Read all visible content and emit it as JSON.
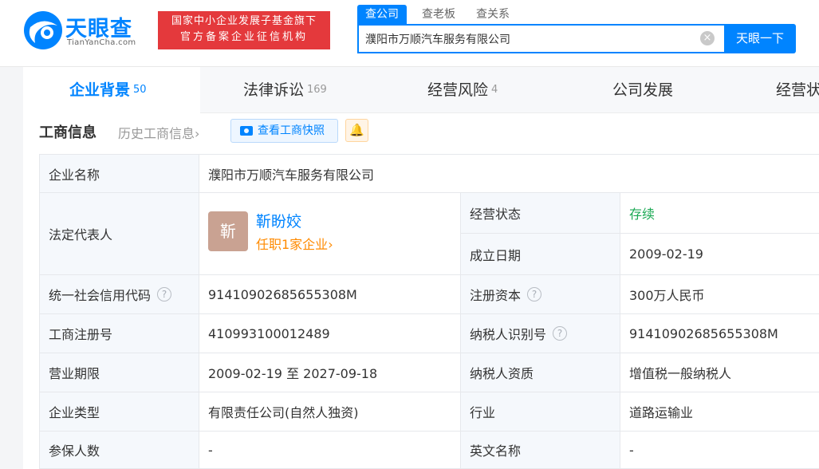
{
  "header": {
    "logo_cn": "天眼查",
    "logo_en": "TianYanCha.com",
    "slogan_line1": "国家中小企业发展子基金旗下",
    "slogan_line2": "官方备案企业征信机构",
    "search_tabs": [
      "查公司",
      "查老板",
      "查关系"
    ],
    "search_value": "濮阳市万顺汽车服务有限公司",
    "search_button": "天眼一下",
    "clear_glyph": "×"
  },
  "nav": {
    "tabs": [
      {
        "label": "企业背景",
        "count": "50"
      },
      {
        "label": "法律诉讼",
        "count": "169"
      },
      {
        "label": "经营风险",
        "count": "4"
      },
      {
        "label": "公司发展",
        "count": ""
      },
      {
        "label": "经营状",
        "count": ""
      }
    ]
  },
  "section": {
    "title": "工商信息",
    "history": "历史工商信息",
    "history_arrow": "›",
    "snapshot_button": "查看工商快照",
    "bell_glyph": "🔔"
  },
  "info": {
    "company_name_label": "企业名称",
    "company_name": "濮阳市万顺汽车服务有限公司",
    "legal_rep_label": "法定代表人",
    "legal_rep_avatar": "靳",
    "legal_rep_name": "靳盼姣",
    "legal_rep_sub": "任职1家企业",
    "legal_rep_sub_arrow": "›",
    "status_label": "经营状态",
    "status": "存续",
    "founded_label": "成立日期",
    "founded": "2009-02-19",
    "credit_code_label": "统一社会信用代码",
    "credit_code": "91410902685655308M",
    "capital_label": "注册资本",
    "capital": "300万人民币",
    "reg_no_label": "工商注册号",
    "reg_no": "410993100012489",
    "taxpayer_id_label": "纳税人识别号",
    "taxpayer_id": "91410902685655308M",
    "term_label": "营业期限",
    "term": "2009-02-19 至 2027-09-18",
    "taxpayer_qual_label": "纳税人资质",
    "taxpayer_qual": "增值税一般纳税人",
    "type_label": "企业类型",
    "type": "有限责任公司(自然人独资)",
    "industry_label": "行业",
    "industry": "道路运输业",
    "insured_label": "参保人数",
    "insured": "-",
    "english_name_label": "英文名称",
    "english_name": "-",
    "help_glyph": "?"
  },
  "colors": {
    "brand": "#0084ff",
    "slogan_bg": "#e4393c",
    "status": "#1aa853",
    "accent_orange": "#ff8a00",
    "label_bg": "#f5f8fc"
  }
}
